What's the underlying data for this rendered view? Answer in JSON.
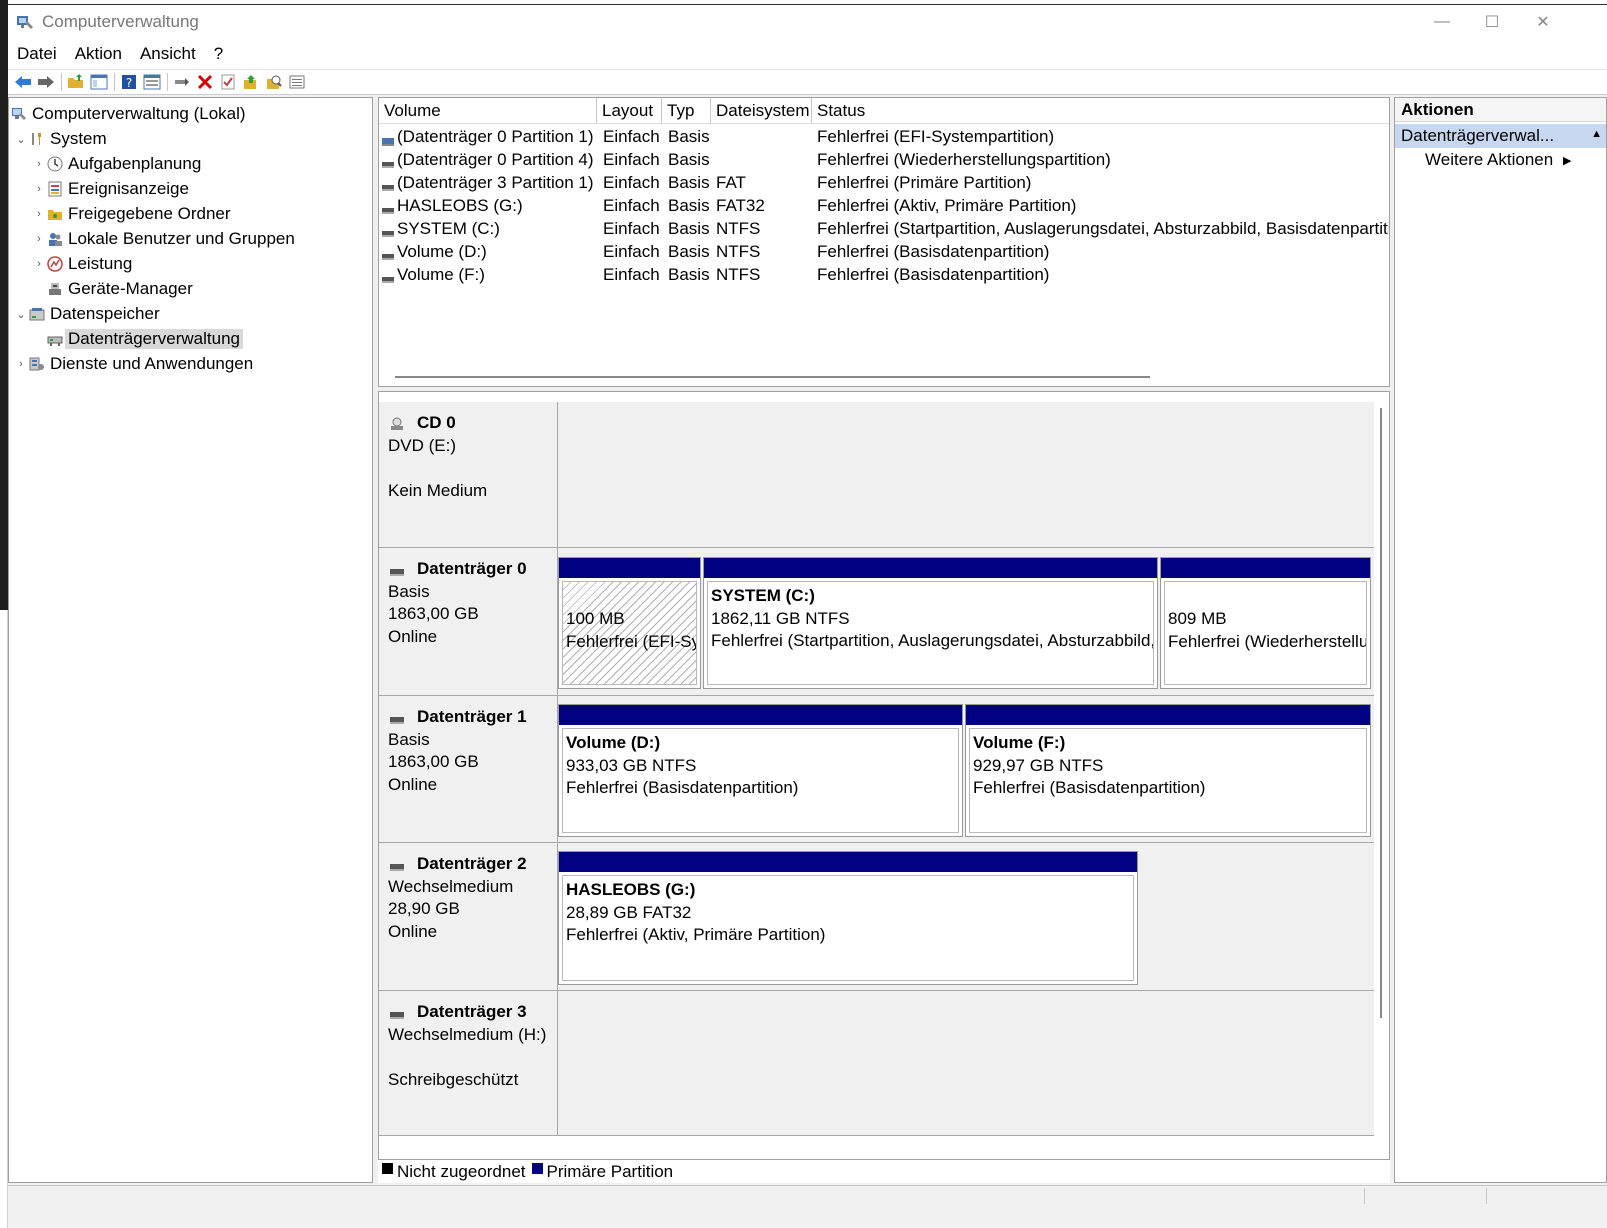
{
  "window": {
    "title": "Computerverwaltung",
    "controls": {
      "minimize": "—",
      "maximize": "☐",
      "close": "✕"
    }
  },
  "menu": [
    "Datei",
    "Aktion",
    "Ansicht",
    "?"
  ],
  "toolbar": [
    {
      "icon": "back-arrow-icon",
      "color": "#2e7bd6"
    },
    {
      "icon": "forward-arrow-icon",
      "color": "#666666"
    },
    {
      "icon": "up-folder-icon",
      "color": "#e0b030"
    },
    {
      "icon": "show-hide-tree-icon",
      "color": "#4a74b0"
    },
    {
      "icon": "help-icon",
      "color": "#2050a0"
    },
    {
      "icon": "properties-view-icon",
      "color": "#4a74b0"
    },
    {
      "icon": "connect-icon",
      "color": "#555555"
    },
    {
      "icon": "delete-icon",
      "color": "#d40000"
    },
    {
      "icon": "check-icon",
      "color": "#c04040"
    },
    {
      "icon": "export-icon",
      "color": "#e0b030"
    },
    {
      "icon": "search-icon",
      "color": "#e0b030"
    },
    {
      "icon": "list-view-icon",
      "color": "#555555"
    }
  ],
  "tree": {
    "items": [
      {
        "label": "Computerverwaltung (Lokal)",
        "level": 0,
        "expander": "",
        "icon": "computer-management-icon"
      },
      {
        "label": "System",
        "level": 1,
        "expander": "⌄",
        "icon": "tools-icon"
      },
      {
        "label": "Aufgabenplanung",
        "level": 2,
        "expander": "›",
        "icon": "clock-icon"
      },
      {
        "label": "Ereignisanzeige",
        "level": 2,
        "expander": "›",
        "icon": "event-viewer-icon"
      },
      {
        "label": "Freigegebene Ordner",
        "level": 2,
        "expander": "›",
        "icon": "shared-folder-icon"
      },
      {
        "label": "Lokale Benutzer und Gruppen",
        "level": 2,
        "expander": "›",
        "icon": "users-icon"
      },
      {
        "label": "Leistung",
        "level": 2,
        "expander": "›",
        "icon": "performance-icon"
      },
      {
        "label": "Geräte-Manager",
        "level": 2,
        "expander": "",
        "icon": "device-manager-icon"
      },
      {
        "label": "Datenspeicher",
        "level": 1,
        "expander": "⌄",
        "icon": "storage-icon"
      },
      {
        "label": "Datenträgerverwaltung",
        "level": 2,
        "expander": "",
        "icon": "disk-management-icon",
        "selected": true
      },
      {
        "label": "Dienste und Anwendungen",
        "level": 1,
        "expander": "›",
        "icon": "services-icon"
      }
    ]
  },
  "volumes": {
    "headers": [
      "Volume",
      "Layout",
      "Typ",
      "Dateisystem",
      "Status"
    ],
    "rows": [
      {
        "volume": "(Datenträger 0 Partition 1)",
        "layout": "Einfach",
        "typ": "Basis",
        "fs": "",
        "status": "Fehlerfrei (EFI-Systempartition)",
        "highlight": true
      },
      {
        "volume": "(Datenträger 0 Partition 4)",
        "layout": "Einfach",
        "typ": "Basis",
        "fs": "",
        "status": "Fehlerfrei (Wiederherstellungspartition)"
      },
      {
        "volume": "(Datenträger 3 Partition 1)",
        "layout": "Einfach",
        "typ": "Basis",
        "fs": "FAT",
        "status": "Fehlerfrei (Primäre Partition)"
      },
      {
        "volume": "HASLEOBS (G:)",
        "layout": "Einfach",
        "typ": "Basis",
        "fs": "FAT32",
        "status": "Fehlerfrei (Aktiv, Primäre Partition)"
      },
      {
        "volume": "SYSTEM (C:)",
        "layout": "Einfach",
        "typ": "Basis",
        "fs": "NTFS",
        "status": "Fehlerfrei (Startpartition, Auslagerungsdatei, Absturzabbild, Basisdatenpartitio"
      },
      {
        "volume": "Volume (D:)",
        "layout": "Einfach",
        "typ": "Basis",
        "fs": "NTFS",
        "status": "Fehlerfrei (Basisdatenpartition)"
      },
      {
        "volume": "Volume (F:)",
        "layout": "Einfach",
        "typ": "Basis",
        "fs": "NTFS",
        "status": "Fehlerfrei (Basisdatenpartition)"
      }
    ]
  },
  "disks": [
    {
      "name": "CD 0",
      "line1": "DVD (E:)",
      "line2": "",
      "line3": "Kein Medium",
      "icon": "cd-drive-icon",
      "partitions": []
    },
    {
      "name": "Datenträger 0",
      "line1": "Basis",
      "line2": "1863,00 GB",
      "line3": "Online",
      "icon": "disk-drive-icon",
      "partitions": [
        {
          "title": "",
          "size": "100 MB",
          "status": "Fehlerfrei (EFI-Systempartition)",
          "hatched": true
        },
        {
          "title": "SYSTEM  (C:)",
          "size": "1862,11 GB NTFS",
          "status": "Fehlerfrei (Startpartition, Auslagerungsdatei, Absturzabbild, Basisdatenpartition)"
        },
        {
          "title": "",
          "size": "809 MB",
          "status": "Fehlerfrei (Wiederherstellungspartition)"
        }
      ]
    },
    {
      "name": "Datenträger 1",
      "line1": "Basis",
      "line2": "1863,00 GB",
      "line3": "Online",
      "icon": "disk-drive-icon",
      "partitions": [
        {
          "title": "Volume  (D:)",
          "size": "933,03 GB NTFS",
          "status": "Fehlerfrei (Basisdatenpartition)"
        },
        {
          "title": "Volume  (F:)",
          "size": "929,97 GB NTFS",
          "status": "Fehlerfrei (Basisdatenpartition)"
        }
      ]
    },
    {
      "name": "Datenträger 2",
      "line1": "Wechselmedium",
      "line2": "28,90 GB",
      "line3": "Online",
      "icon": "removable-drive-icon",
      "partitions": [
        {
          "title": "HASLEOBS  (G:)",
          "size": "28,89 GB FAT32",
          "status": "Fehlerfrei (Aktiv, Primäre Partition)"
        }
      ]
    },
    {
      "name": "Datenträger 3",
      "line1": "Wechselmedium (H:)",
      "line2": "",
      "line3": "Schreibgeschützt",
      "icon": "removable-drive-icon",
      "partitions": []
    }
  ],
  "legend": [
    {
      "label": "Nicht zugeordnet",
      "color": "#000000"
    },
    {
      "label": "Primäre Partition",
      "color": "#000080"
    }
  ],
  "actions": {
    "header": "Aktionen",
    "section": "Datenträgerverwal...",
    "section_arrow": "▲",
    "item": "Weitere Aktionen",
    "item_arrow": "▶"
  }
}
